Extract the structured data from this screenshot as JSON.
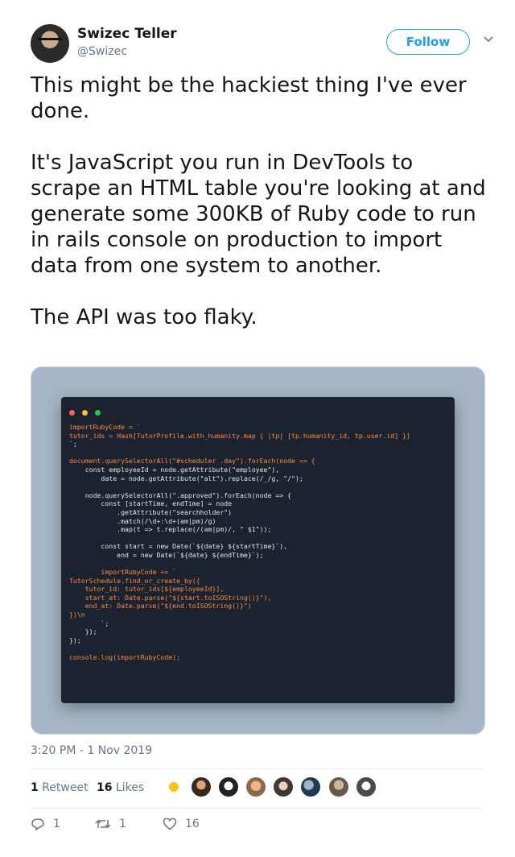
{
  "author": {
    "name": "Swizec Teller",
    "handle": "@Swizec"
  },
  "follow_label": "Follow",
  "icons": {
    "more": "chevron-down-icon",
    "reply": "reply-icon",
    "retweet": "retweet-icon",
    "like": "heart-icon"
  },
  "tweet_text": "This might be the hackiest thing I've ever done.\n\nIt's JavaScript you run in DevTools to scrape an HTML table you're looking at and generate some 300KB of Ruby code to run in rails console on production to import data from one system to another.\n\nThe API was too flaky.",
  "code_lines": [
    "importRubyCode = `",
    "tutor_ids = Hash[TutorProfile.with_humanity.map { |tp| [tp.humanity_id, tp.user.id] }]",
    "`;",
    "",
    "document.querySelectorAll(\"#scheduler .day\").forEach(node => {",
    "    const employeeId = node.getAttribute(\"employee\"),",
    "        date = node.getAttribute(\"alt\").replace(/_/g, \"/\");",
    "",
    "    node.querySelectorAll(\".approved\").forEach(node => {",
    "        const [startTime, endTime] = node",
    "            .getAttribute(\"searchholder\")",
    "            .match(/\\d+:\\d+(am|pm)/g)",
    "            .map(t => t.replace(/(am|pm)/, \" $1\"));",
    "",
    "        const start = new Date(`${date} ${startTime}`),",
    "            end = new Date(`${date} ${endTime}`);",
    "",
    "        importRubyCode += `",
    "TutorSchedule.find_or_create_by({",
    "    tutor_id: tutor_ids[${employeeId}],",
    "    start_at: Date.parse(\"${start.toISOString()}\"),",
    "    end_at: Date.parse(\"${end.toISOString()}\")",
    "})\\n",
    "        `;",
    "    });",
    "});",
    "",
    "console.log(importRubyCode);"
  ],
  "timestamp": "3:20 PM - 1 Nov 2019",
  "stats": {
    "retweet_count": "1",
    "retweet_label": "Retweet",
    "like_count": "16",
    "like_label": "Likes"
  },
  "actions": {
    "reply_count": "1",
    "retweet_count": "1",
    "like_count": "16"
  },
  "colors": {
    "accent": "#1da1f2",
    "code_bg": "#1b2230",
    "code_orange": "#ff8a3d",
    "code_cyan": "#5fd3e6"
  }
}
